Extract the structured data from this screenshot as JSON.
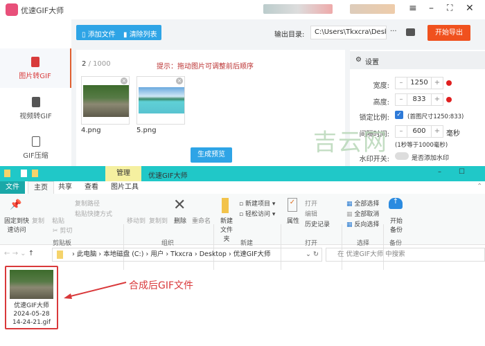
{
  "app": {
    "title": "优速GIF大师",
    "add_file": "添加文件",
    "clear_list": "清除列表",
    "output_label": "输出目录:",
    "output_path": "C:\\Users\\Tkxcra\\Deskto",
    "more": "···",
    "start_export": "开始导出",
    "sidebar": [
      {
        "label": "图片转GIF",
        "active": true
      },
      {
        "label": "视频转GIF"
      },
      {
        "label": "GIF压缩"
      }
    ],
    "count_current": "2",
    "count_total": "/ 1000",
    "hint": "提示：拖动图片可调整前后顺序",
    "images": [
      {
        "name": "4.png"
      },
      {
        "name": "5.png"
      }
    ],
    "preview_button": "生成预览",
    "settings": {
      "title": "设置",
      "width_label": "宽度:",
      "width": "1250",
      "height_label": "高度:",
      "height": "833",
      "lock_label": "锁定比例:",
      "lock_note": "(首图尺寸1250:833)",
      "lock_checked": true,
      "interval_label": "间隔时间:",
      "interval": "600",
      "interval_unit": "毫秒",
      "interval_note": "(1秒等于1000毫秒)",
      "watermark_label": "水印开关:",
      "watermark_note": "是否添加水印",
      "watermark_on": false
    },
    "watermark_text": "吉云网",
    "accent": "#2ea4e6",
    "export_color": "#f0511e"
  },
  "explorer": {
    "context_tab": "管理",
    "title": "优速GIF大师",
    "tabs": [
      "文件",
      "主页",
      "共享",
      "查看",
      "图片工具"
    ],
    "ribbon": {
      "pin": "固定到快速访问",
      "copy": "复制",
      "paste": "粘贴",
      "copy_path": "复制路径",
      "paste_shortcut": "粘贴快捷方式",
      "cut": "剪切",
      "clipboard": "剪贴板",
      "move_to": "移动到",
      "copy_to": "复制到",
      "delete": "删除",
      "rename": "重命名",
      "organize": "组织",
      "new_folder": "新建文件夹",
      "new_item": "新建项目",
      "easy_access": "轻松访问",
      "new": "新建",
      "properties": "属性",
      "open": "打开",
      "edit": "编辑",
      "history": "历史记录",
      "open_group": "打开",
      "select_all": "全部选择",
      "select_none": "全部取消",
      "invert": "反向选择",
      "select": "选择",
      "backup": "开始备份",
      "backup_group": "备份"
    },
    "path": [
      "此电脑",
      "本地磁盘 (C:)",
      "用户",
      "Tkxcra",
      "Desktop",
      "优速GIF大师"
    ],
    "search_placeholder": "在 优速GIF大师 中搜索",
    "file": {
      "line1": "优速GIF大师",
      "line2": "2024-05-28",
      "line3": "14-24-21.gif"
    },
    "annotation": "合成后GIF文件",
    "annotation_color": "#d9383a"
  }
}
